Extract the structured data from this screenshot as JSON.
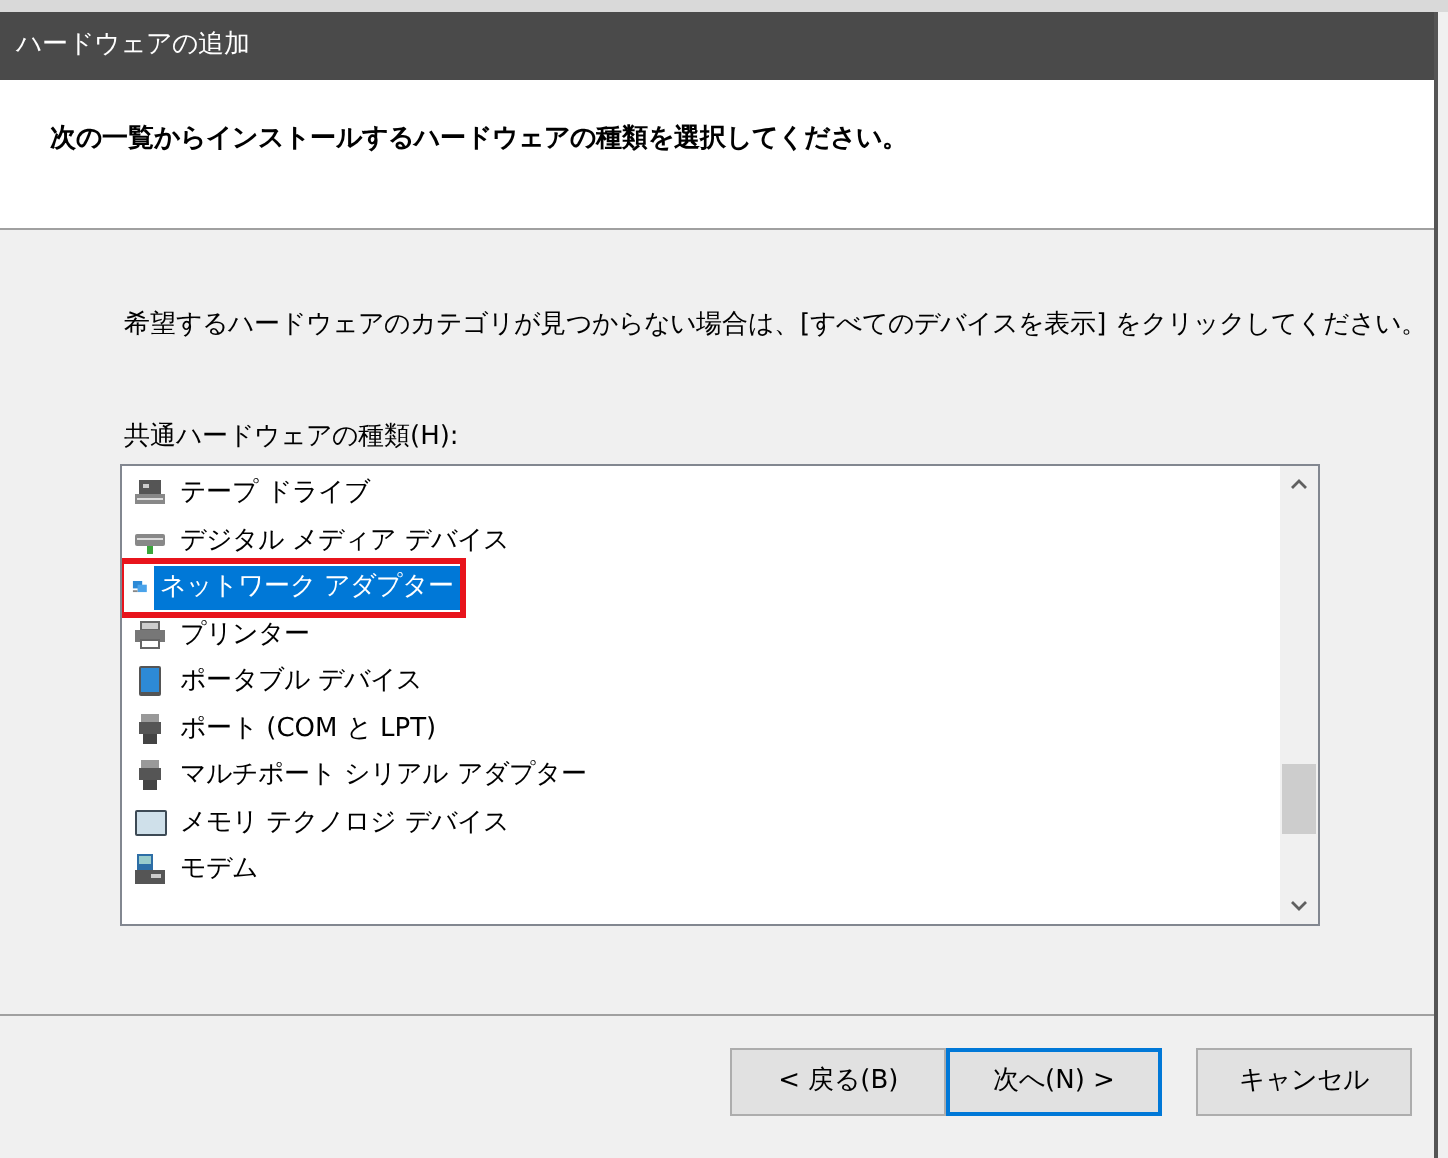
{
  "window": {
    "title": "ハードウェアの追加"
  },
  "header": {
    "heading": "次の一覧からインストールするハードウェアの種類を選択してください。"
  },
  "body": {
    "instruction": "希望するハードウェアのカテゴリが見つからない場合は、[すべてのデバイスを表示] をクリックしてください。",
    "list_label": "共通ハードウェアの種類(H):"
  },
  "hardware_types": [
    {
      "label": "テープ ドライブ",
      "selected": false,
      "highlighted": false
    },
    {
      "label": "デジタル メディア デバイス",
      "selected": false,
      "highlighted": false
    },
    {
      "label": "ネットワーク アダプター",
      "selected": true,
      "highlighted": true
    },
    {
      "label": "プリンター",
      "selected": false,
      "highlighted": false
    },
    {
      "label": "ポータブル デバイス",
      "selected": false,
      "highlighted": false
    },
    {
      "label": "ポート (COM と LPT)",
      "selected": false,
      "highlighted": false
    },
    {
      "label": "マルチポート シリアル アダプター",
      "selected": false,
      "highlighted": false
    },
    {
      "label": "メモリ テクノロジ デバイス",
      "selected": false,
      "highlighted": false
    },
    {
      "label": "モデム",
      "selected": false,
      "highlighted": false
    }
  ],
  "buttons": [
    {
      "label": "< 戻る(B)",
      "default": false
    },
    {
      "label": "次へ(N) >",
      "default": true
    },
    {
      "label": "キャンセル",
      "default": false
    }
  ]
}
